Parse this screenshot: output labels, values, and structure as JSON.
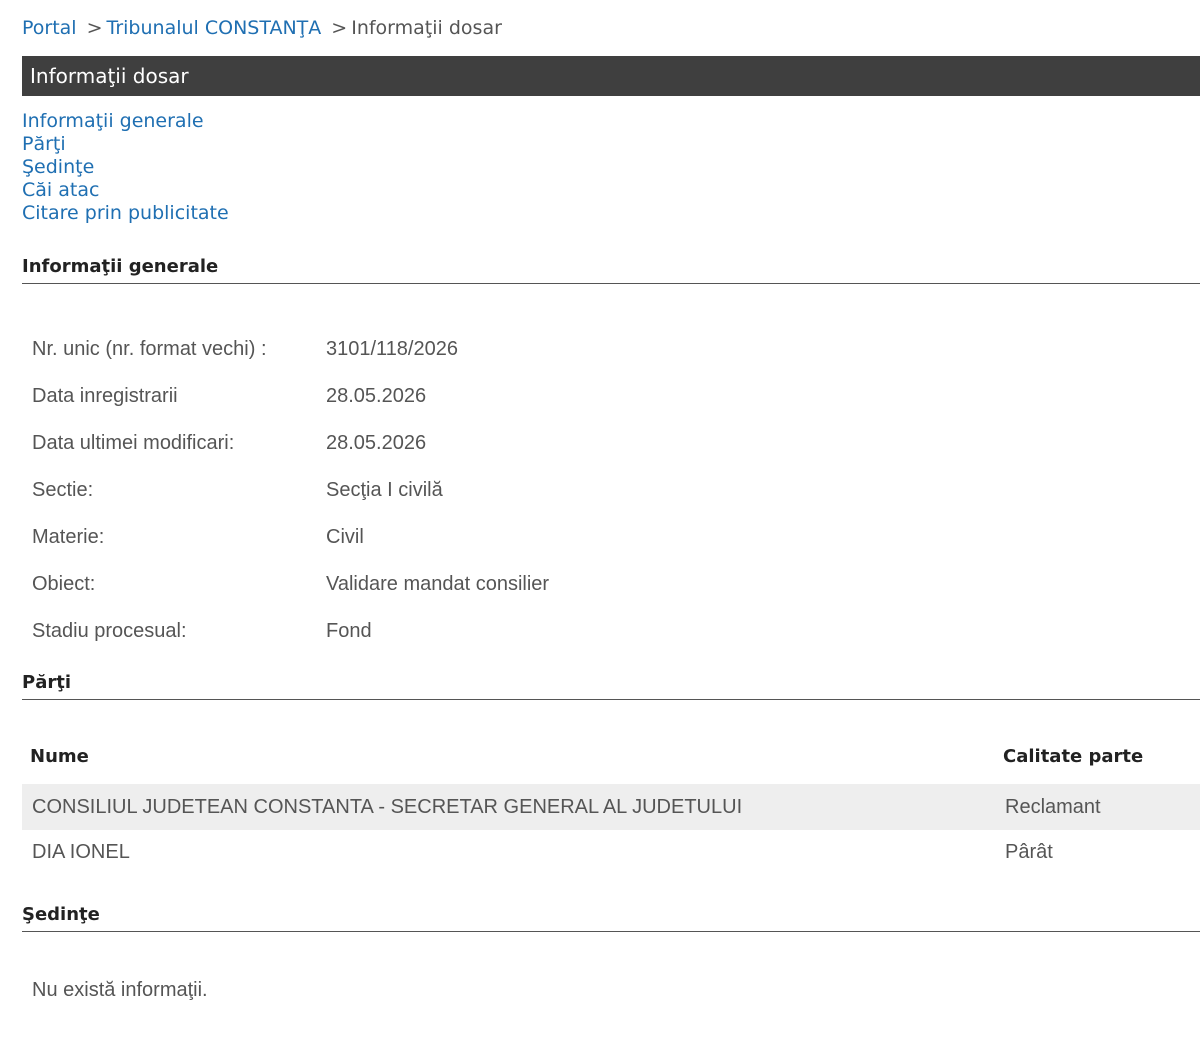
{
  "breadcrumb": {
    "portal": "Portal",
    "court": "Tribunalul CONSTANŢA",
    "current": "Informaţii dosar",
    "separator": ">"
  },
  "title_bar": "Informaţii dosar",
  "section_links": [
    "Informaţii generale",
    "Părţi",
    "Şedinţe",
    "Căi atac",
    "Citare prin publicitate"
  ],
  "general_info": {
    "heading": "Informaţii generale",
    "rows": [
      {
        "label": "Nr. unic (nr. format vechi) :",
        "value": "3101/118/2026"
      },
      {
        "label": "Data inregistrarii",
        "value": "28.05.2026"
      },
      {
        "label": "Data ultimei modificari:",
        "value": "28.05.2026"
      },
      {
        "label": "Sectie:",
        "value": "Secţia I civilă"
      },
      {
        "label": "Materie:",
        "value": "Civil"
      },
      {
        "label": "Obiect:",
        "value": "Validare mandat consilier"
      },
      {
        "label": "Stadiu procesual:",
        "value": "Fond"
      }
    ]
  },
  "parti": {
    "heading": "Părţi",
    "columns": [
      "Nume",
      "Calitate parte"
    ],
    "rows": [
      {
        "name": "CONSILIUL JUDETEAN CONSTANTA - SECRETAR GENERAL AL JUDETULUI",
        "role": "Reclamant"
      },
      {
        "name": "DIA IONEL",
        "role": "Pârât"
      }
    ]
  },
  "sedinte": {
    "heading": "Şedinţe",
    "empty_message": "Nu există informaţii."
  },
  "colors": {
    "link": "#1f6fb2",
    "title_bar_bg": "#3f3f3f",
    "row_shade": "#eeeeee"
  }
}
